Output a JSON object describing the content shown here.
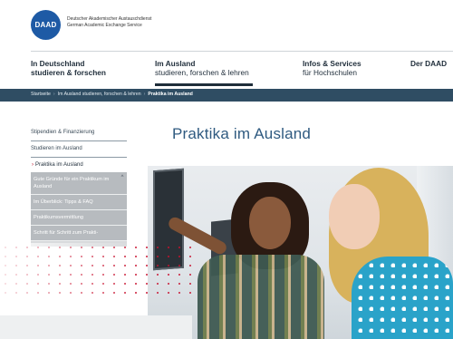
{
  "header": {
    "logo_text": "DAAD",
    "org_line1": "Deutscher Akademischer Austauschdienst",
    "org_line2": "German Academic Exchange Service"
  },
  "nav": [
    {
      "line1": "In Deutschland",
      "line2": "studieren & forschen"
    },
    {
      "line1": "Im Ausland",
      "line2": "studieren, forschen & lehren"
    },
    {
      "line1": "Infos & Services",
      "line2": "für Hochschulen"
    },
    {
      "line1": "Der DAAD",
      "line2": ""
    }
  ],
  "breadcrumb": {
    "items": [
      "Startseite",
      "Im Ausland studieren, forschen & lehren"
    ],
    "current": "Praktika im Ausland",
    "separator": "›"
  },
  "sidebar": {
    "links": [
      "Stipendien & Finanzierung",
      "Studieren im Ausland"
    ],
    "active_marker": "›",
    "active": "Praktika im Ausland",
    "scroll_up": "^",
    "subitems": [
      "Gute Gründe für ein Praktikum im Ausland",
      "Im Überblick: Tipps & FAQ",
      "Praktikumsvermittlung",
      "Schritt für Schritt zum Prakti-"
    ]
  },
  "main": {
    "title": "Praktika im Ausland"
  },
  "colors": {
    "brand_blue": "#1e5aa5",
    "breadcrumb_bg": "#2f4d63",
    "title_blue": "#2f5a80",
    "accent_red": "#c8102e"
  }
}
